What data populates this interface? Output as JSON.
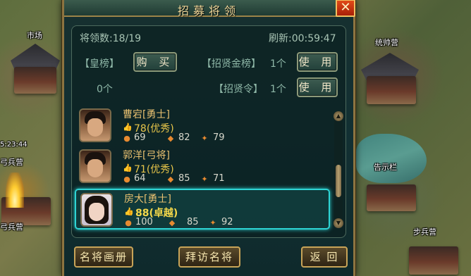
{
  "map_labels": {
    "market": "市场",
    "commander_camp": "统帅营",
    "archer_camp_1": "弓兵营",
    "archer_camp_2": "弓兵营",
    "notice_board": "告示栏",
    "shield_camp": "步兵营",
    "timer": "5:23:44"
  },
  "dialog": {
    "title": "招募将领",
    "close": "✕",
    "general_count_label": "将领数:",
    "general_count": "18/19",
    "refresh_label": "刷新:",
    "refresh_time": "00:59:47",
    "emperor_list_label": "【皇榜】",
    "emperor_count": "0个",
    "buy_button": "购 买",
    "gold_list_label": "【招贤金榜】",
    "gold_list_count": "1个",
    "use_button_1": "使 用",
    "recruit_token_label": "【招贤令】",
    "recruit_token_count": "1个",
    "use_button_2": "使 用"
  },
  "heroes": [
    {
      "name": "曹宕[勇士]",
      "rating": "78(优秀)",
      "stat1": "69",
      "stat2": "82",
      "stat3": "79"
    },
    {
      "name": "郭洋[弓将]",
      "rating": "71(优秀)",
      "stat1": "64",
      "stat2": "85",
      "stat3": "71"
    },
    {
      "name": "房大[勇士]",
      "rating": "88(卓越)",
      "stat1": "100",
      "stat2": "85",
      "stat3": "92"
    }
  ],
  "bottom": {
    "gallery_button": "名将画册",
    "visit_button": "拜访名将",
    "back_button": "返 回"
  },
  "colors": {
    "accent": "#2ed4d4",
    "gold": "#e8c64a",
    "frame": "#8d7440"
  }
}
